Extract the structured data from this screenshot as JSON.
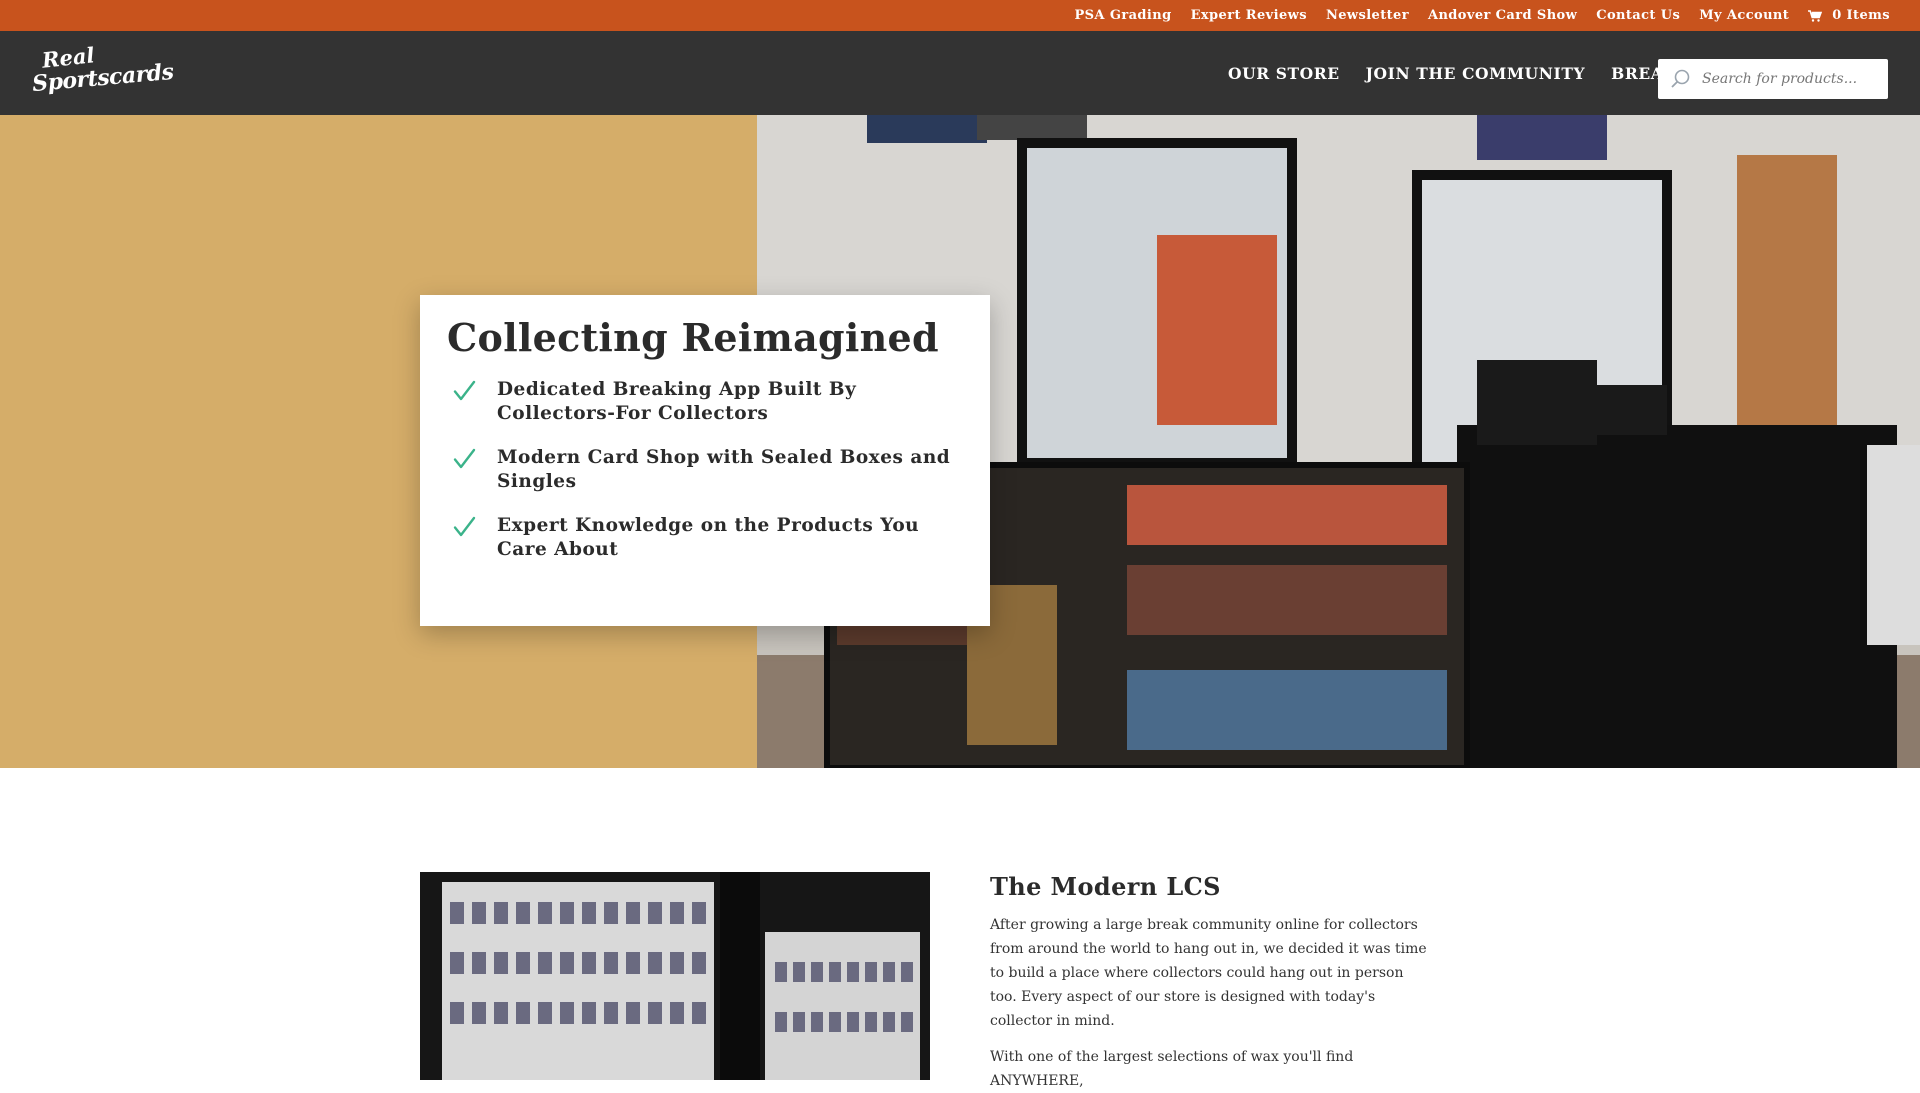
{
  "topbar": {
    "links": [
      "PSA Grading",
      "Expert Reviews",
      "Newsletter",
      "Andover Card Show",
      "Contact Us",
      "My Account"
    ],
    "cart_label": "0 Items",
    "background": "#c8531d"
  },
  "header": {
    "logo_line1": "Real",
    "logo_line2": "Sportscards",
    "nav": [
      "OUR STORE",
      "JOIN THE COMMUNITY",
      "BREAKS"
    ],
    "search_placeholder": "Search for products...",
    "background": "#333333"
  },
  "hero": {
    "title": "Collecting Reimagined",
    "bullets": [
      "Dedicated Breaking App Built By Collectors-For Collectors",
      "Modern Card Shop with Sealed Boxes and Singles",
      "Expert Knowledge on the Products You Care About"
    ],
    "accent": "#d5ad69",
    "check_color": "#3bb38a"
  },
  "about": {
    "title": "The Modern LCS",
    "paragraphs": [
      "After growing a large break community online for collectors from around the world to hang out in, we decided it was time to build a place where collectors could hang out in person too. Every aspect of our store is designed with today's collector in mind.",
      "With one of the largest selections of wax you'll find ANYWHERE,"
    ]
  },
  "icons": {
    "cart": "cart-icon",
    "chevron": "chevron-down-icon",
    "search": "search-icon",
    "check": "checkmark-icon"
  }
}
